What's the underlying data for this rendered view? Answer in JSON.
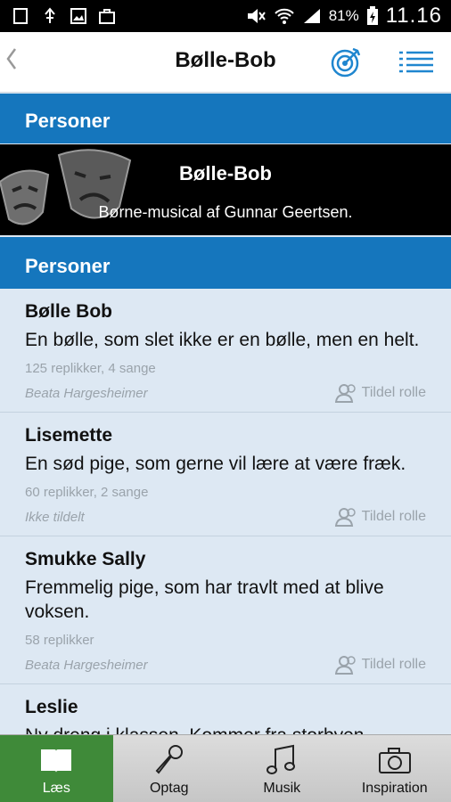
{
  "status": {
    "battery": "81%",
    "time": "11.16"
  },
  "nav": {
    "title": "Bølle-Bob",
    "back_icon": "chevron-left-icon",
    "target_icon": "target-icon",
    "menu_icon": "list-icon"
  },
  "sections": {
    "top_header": "Personer",
    "list_header": "Personer"
  },
  "banner": {
    "title": "Bølle-Bob",
    "subtitle": "Børne-musical af Gunnar Geertsen."
  },
  "items": [
    {
      "name": "Bølle Bob",
      "desc": "En bølle, som slet ikke er en bølle, men en helt.",
      "stats": "125 replikker, 4 sange",
      "actor": "Beata Hargesheimer",
      "assign": "Tildel rolle"
    },
    {
      "name": "Lisemette",
      "desc": "En sød pige, som gerne vil lære at være fræk.",
      "stats": "60 replikker, 2 sange",
      "actor": "Ikke tildelt",
      "assign": "Tildel rolle"
    },
    {
      "name": "Smukke Sally",
      "desc": "Fremmelig pige, som har travlt med at blive voksen.",
      "stats": "58 replikker",
      "actor": "Beata Hargesheimer",
      "assign": "Tildel rolle"
    },
    {
      "name": "Leslie",
      "desc": "Ny dreng i klassen. Kommer fra storbyen.",
      "stats": "",
      "actor": "",
      "assign": ""
    }
  ],
  "tabs": [
    {
      "label": "Læs",
      "icon": "book-icon"
    },
    {
      "label": "Optag",
      "icon": "microphone-icon"
    },
    {
      "label": "Musik",
      "icon": "music-note-icon"
    },
    {
      "label": "Inspiration",
      "icon": "camera-icon"
    }
  ],
  "colors": {
    "primary_blue": "#1576bd",
    "active_tab": "#3f8a39",
    "list_bg": "#dde8f3"
  }
}
